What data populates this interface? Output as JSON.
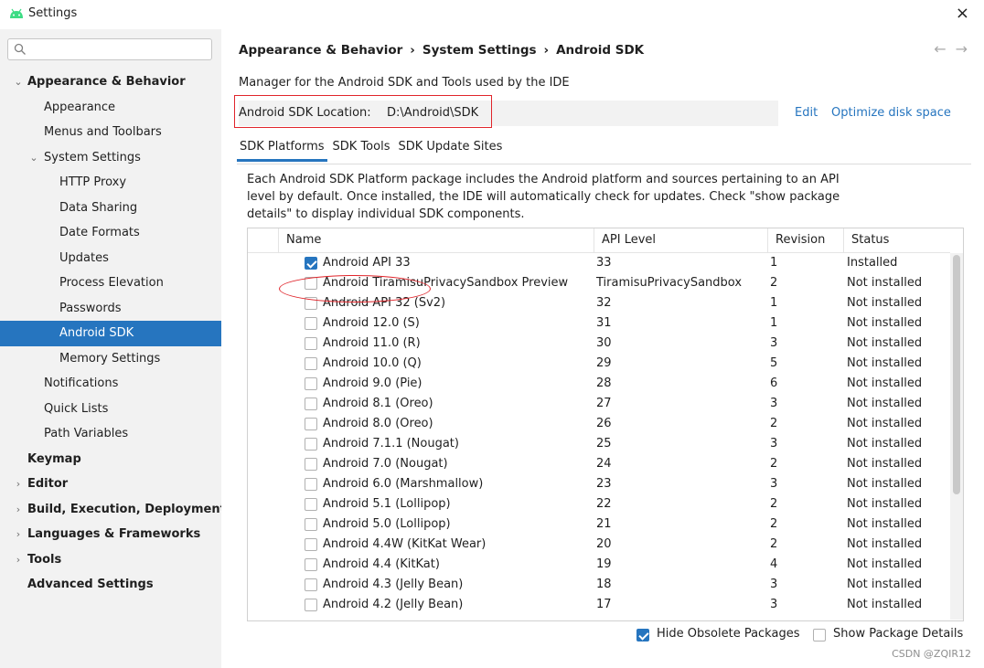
{
  "window": {
    "title": "Settings",
    "close_glyph": "×"
  },
  "colors": {
    "accent": "#2675bf",
    "selection": "#2675bf",
    "annotation": "#e0252b"
  },
  "icons": {
    "app": "android-icon",
    "search": "search-icon",
    "close": "close-icon"
  },
  "sidebar": {
    "search_placeholder": "",
    "items": [
      {
        "label": "Appearance & Behavior",
        "level": 0,
        "chevron": "⌄",
        "bold": true
      },
      {
        "label": "Appearance",
        "level": 1
      },
      {
        "label": "Menus and Toolbars",
        "level": 1
      },
      {
        "label": "System Settings",
        "level": 1,
        "chevron": "⌄"
      },
      {
        "label": "HTTP Proxy",
        "level": 2
      },
      {
        "label": "Data Sharing",
        "level": 2
      },
      {
        "label": "Date Formats",
        "level": 2
      },
      {
        "label": "Updates",
        "level": 2
      },
      {
        "label": "Process Elevation",
        "level": 2
      },
      {
        "label": "Passwords",
        "level": 2
      },
      {
        "label": "Android SDK",
        "level": 2,
        "selected": true
      },
      {
        "label": "Memory Settings",
        "level": 2
      },
      {
        "label": "Notifications",
        "level": 1
      },
      {
        "label": "Quick Lists",
        "level": 1
      },
      {
        "label": "Path Variables",
        "level": 1
      },
      {
        "label": "Keymap",
        "level": 0,
        "bold": true
      },
      {
        "label": "Editor",
        "level": 0,
        "chevron": "›",
        "bold": true
      },
      {
        "label": "Build, Execution, Deployment",
        "level": 0,
        "chevron": "›",
        "bold": true
      },
      {
        "label": "Languages & Frameworks",
        "level": 0,
        "chevron": "›",
        "bold": true
      },
      {
        "label": "Tools",
        "level": 0,
        "chevron": "›",
        "bold": true
      },
      {
        "label": "Advanced Settings",
        "level": 0,
        "bold": true
      }
    ]
  },
  "breadcrumb": {
    "parts": [
      "Appearance & Behavior",
      "System Settings",
      "Android SDK"
    ],
    "separator": "›"
  },
  "nav": {
    "back": "←",
    "forward": "→"
  },
  "main": {
    "description": "Manager for the Android SDK and Tools used by the IDE",
    "sdk_location_label": "Android SDK Location:",
    "sdk_location_value": "D:\\Android\\SDK",
    "edit_link": "Edit",
    "optimize_link": "Optimize disk space"
  },
  "tabs": [
    {
      "label": "SDK Platforms",
      "active": true
    },
    {
      "label": "SDK Tools"
    },
    {
      "label": "SDK Update Sites"
    }
  ],
  "panel_description": "Each Android SDK Platform package includes the Android platform and sources pertaining to an API level by default. Once installed, the IDE will automatically check for updates. Check \"show package details\" to display individual SDK components.",
  "table": {
    "columns": [
      "Name",
      "API Level",
      "Revision",
      "Status"
    ],
    "rows": [
      {
        "name": "Android API 33",
        "api": "33",
        "rev": "1",
        "status": "Installed",
        "checked": true
      },
      {
        "name": "Android TiramisuPrivacySandbox Preview",
        "api": "TiramisuPrivacySandbox",
        "rev": "2",
        "status": "Not installed",
        "checked": false
      },
      {
        "name": "Android API 32 (Sv2)",
        "api": "32",
        "rev": "1",
        "status": "Not installed",
        "checked": false
      },
      {
        "name": "Android 12.0 (S)",
        "api": "31",
        "rev": "1",
        "status": "Not installed",
        "checked": false
      },
      {
        "name": "Android 11.0 (R)",
        "api": "30",
        "rev": "3",
        "status": "Not installed",
        "checked": false
      },
      {
        "name": "Android 10.0 (Q)",
        "api": "29",
        "rev": "5",
        "status": "Not installed",
        "checked": false
      },
      {
        "name": "Android 9.0 (Pie)",
        "api": "28",
        "rev": "6",
        "status": "Not installed",
        "checked": false
      },
      {
        "name": "Android 8.1 (Oreo)",
        "api": "27",
        "rev": "3",
        "status": "Not installed",
        "checked": false
      },
      {
        "name": "Android 8.0 (Oreo)",
        "api": "26",
        "rev": "2",
        "status": "Not installed",
        "checked": false
      },
      {
        "name": "Android 7.1.1 (Nougat)",
        "api": "25",
        "rev": "3",
        "status": "Not installed",
        "checked": false
      },
      {
        "name": "Android 7.0 (Nougat)",
        "api": "24",
        "rev": "2",
        "status": "Not installed",
        "checked": false
      },
      {
        "name": "Android 6.0 (Marshmallow)",
        "api": "23",
        "rev": "3",
        "status": "Not installed",
        "checked": false
      },
      {
        "name": "Android 5.1 (Lollipop)",
        "api": "22",
        "rev": "2",
        "status": "Not installed",
        "checked": false
      },
      {
        "name": "Android 5.0 (Lollipop)",
        "api": "21",
        "rev": "2",
        "status": "Not installed",
        "checked": false
      },
      {
        "name": "Android 4.4W (KitKat Wear)",
        "api": "20",
        "rev": "2",
        "status": "Not installed",
        "checked": false
      },
      {
        "name": "Android 4.4 (KitKat)",
        "api": "19",
        "rev": "4",
        "status": "Not installed",
        "checked": false
      },
      {
        "name": "Android 4.3 (Jelly Bean)",
        "api": "18",
        "rev": "3",
        "status": "Not installed",
        "checked": false
      },
      {
        "name": "Android 4.2 (Jelly Bean)",
        "api": "17",
        "rev": "3",
        "status": "Not installed",
        "checked": false
      }
    ]
  },
  "options": {
    "hide_obsolete": {
      "label": "Hide Obsolete Packages",
      "checked": true
    },
    "show_details": {
      "label": "Show Package Details",
      "checked": false
    }
  },
  "watermark": "CSDN @ZQIR12"
}
